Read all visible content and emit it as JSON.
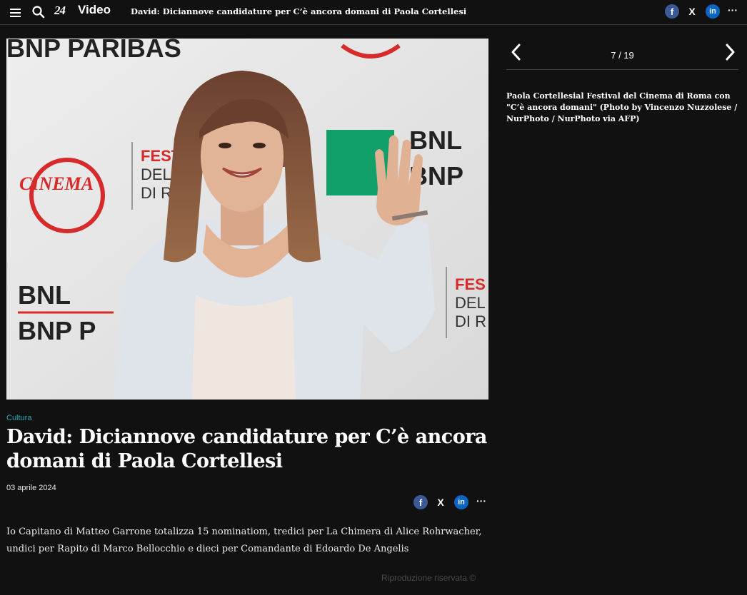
{
  "header": {
    "logo": "24",
    "section": "Video",
    "headline": "David: Diciannove candidature per C’è ancora domani di Paola Cortellesi",
    "share": {
      "facebook": "f",
      "x": "X",
      "linkedin": "in",
      "more": "···"
    }
  },
  "photo": {
    "alt_icon": "photo-icon",
    "backdrop_texts": [
      "BNP PARIBAS",
      "CINEMA",
      "FESTA",
      "DEL C",
      "DI RO",
      "BNL",
      "BNP",
      "BNL",
      "BNP P",
      "FES",
      "DEL",
      "DI R"
    ]
  },
  "article": {
    "category": "Cultura",
    "title": "David: Diciannove candidature per C’è ancora domani di Paola Cortellesi",
    "date": "03 aprile 2024",
    "summary": "Io Capitano di Matteo Garrone totalizza 15 nominatiom, tredici per La Chimera di Alice Rohrwacher, undici per Rapito di Marco Bellocchio e dieci per Comandante di Edoardo De Angelis",
    "rights": "Riproduzione riservata ©",
    "share": {
      "facebook": "f",
      "x": "X",
      "linkedin": "in",
      "more": "···"
    }
  },
  "gallery": {
    "counter": "7 / 19",
    "caption": "Paola Cortellesial Festival del Cinema di Roma con \"C’è ancora domani\" (Photo by Vincenzo Nuzzolese / NurPhoto / NurPhoto via AFP)"
  },
  "colors": {
    "background": "#111111",
    "accent": "#27a8b8",
    "facebook": "#3b5998",
    "linkedin": "#0a66c2"
  }
}
